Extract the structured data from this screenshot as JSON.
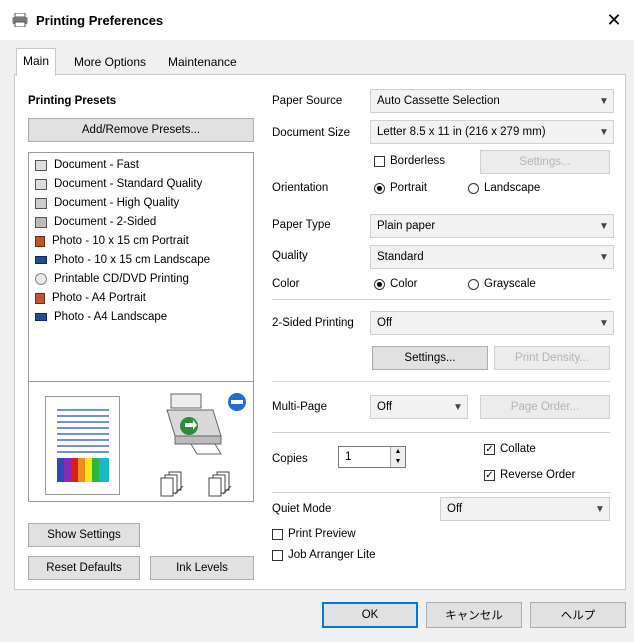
{
  "window": {
    "title": "Printing Preferences",
    "close": "✕"
  },
  "tabs": [
    {
      "label": "Main"
    },
    {
      "label": "More Options"
    },
    {
      "label": "Maintenance"
    }
  ],
  "presets": {
    "heading": "Printing Presets",
    "add_remove": "Add/Remove Presets...",
    "items": [
      {
        "label": "Document - Fast"
      },
      {
        "label": "Document - Standard Quality"
      },
      {
        "label": "Document - High Quality"
      },
      {
        "label": "Document - 2-Sided"
      },
      {
        "label": "Photo - 10 x 15 cm Portrait"
      },
      {
        "label": "Photo - 10 x 15 cm Landscape"
      },
      {
        "label": "Printable CD/DVD Printing"
      },
      {
        "label": "Photo - A4 Portrait"
      },
      {
        "label": "Photo - A4 Landscape"
      }
    ]
  },
  "left_buttons": {
    "show_settings": "Show Settings",
    "reset_defaults": "Reset Defaults",
    "ink_levels": "Ink Levels"
  },
  "settings": {
    "paper_source": {
      "label": "Paper Source",
      "value": "Auto Cassette Selection"
    },
    "document_size": {
      "label": "Document Size",
      "value": "Letter 8.5 x 11 in (216 x 279 mm)"
    },
    "borderless": {
      "label": "Borderless",
      "checked": false
    },
    "borderless_settings": "Settings...",
    "orientation": {
      "label": "Orientation",
      "portrait": "Portrait",
      "landscape": "Landscape",
      "selected": "Portrait"
    },
    "paper_type": {
      "label": "Paper Type",
      "value": "Plain paper"
    },
    "quality": {
      "label": "Quality",
      "value": "Standard"
    },
    "color": {
      "label": "Color",
      "color": "Color",
      "grayscale": "Grayscale",
      "selected": "Color"
    },
    "two_sided": {
      "label": "2-Sided Printing",
      "value": "Off"
    },
    "two_sided_settings": "Settings...",
    "print_density": "Print Density...",
    "multi_page": {
      "label": "Multi-Page",
      "value": "Off"
    },
    "page_order": "Page Order...",
    "copies": {
      "label": "Copies",
      "value": "1"
    },
    "collate": {
      "label": "Collate",
      "checked": true
    },
    "reverse_order": {
      "label": "Reverse Order",
      "checked": true
    },
    "quiet_mode": {
      "label": "Quiet Mode",
      "value": "Off"
    },
    "print_preview": {
      "label": "Print Preview",
      "checked": false
    },
    "job_arranger": {
      "label": "Job Arranger Lite",
      "checked": false
    }
  },
  "footer": {
    "ok": "OK",
    "cancel": "キャンセル",
    "help": "ヘルプ"
  },
  "icons": {
    "close": "close-icon",
    "chevron": "chevron-down-icon",
    "printer": "printer-icon",
    "globe": "globe-icon"
  },
  "colors": {
    "accent": "#0078d7",
    "panel_bg": "#ffffff",
    "window_bg": "#f0f0f0"
  }
}
